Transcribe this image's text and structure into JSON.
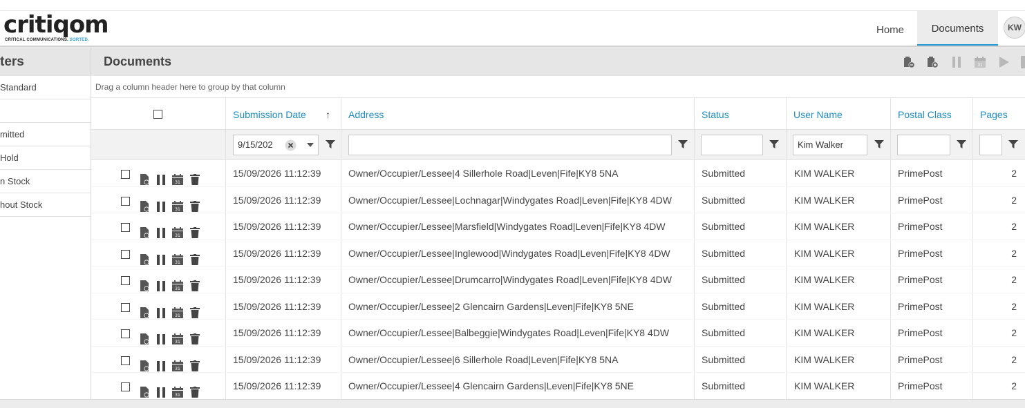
{
  "app": {
    "logo_text": "critiqom",
    "logo_tagline": "CRITICAL COMMUNICATIONS.",
    "logo_tagline_accent": "SORTED."
  },
  "nav": {
    "home": "Home",
    "documents": "Documents",
    "avatar_initials": "KW"
  },
  "sidebar": {
    "title": "ters",
    "items": [
      {
        "label": "Standard"
      },
      {
        "label": ""
      },
      {
        "label": "mitted"
      },
      {
        "label": "Hold"
      },
      {
        "label": "n Stock"
      },
      {
        "label": "hout Stock"
      }
    ]
  },
  "main": {
    "title": "Documents",
    "group_hint": "Drag a column header here to group by that column"
  },
  "grid": {
    "columns": {
      "submission_date": "Submission Date",
      "address": "Address",
      "status": "Status",
      "user_name": "User Name",
      "postal_class": "Postal Class",
      "pages": "Pages"
    },
    "sort_indicator": "↑",
    "filters": {
      "submission_date": "9/15/202",
      "address": "",
      "status": "",
      "user_name": "Kim Walker",
      "postal_class": "",
      "pages": ""
    },
    "rows": [
      {
        "date": "15/09/2026 11:12:39",
        "address": "Owner/Occupier/Lessee|4 Sillerhole Road|Leven|Fife|KY8 5NA",
        "status": "Submitted",
        "user": "KIM WALKER",
        "postal": "PrimePost",
        "pages": "2"
      },
      {
        "date": "15/09/2026 11:12:39",
        "address": "Owner/Occupier/Lessee|Lochnagar|Windygates Road|Leven|Fife|KY8 4DW",
        "status": "Submitted",
        "user": "KIM WALKER",
        "postal": "PrimePost",
        "pages": "2"
      },
      {
        "date": "15/09/2026 11:12:39",
        "address": "Owner/Occupier/Lessee|Marsfield|Windygates Road|Leven|Fife|KY8 4DW",
        "status": "Submitted",
        "user": "KIM WALKER",
        "postal": "PrimePost",
        "pages": "2"
      },
      {
        "date": "15/09/2026 11:12:39",
        "address": "Owner/Occupier/Lessee|Inglewood|Windygates Road|Leven|Fife|KY8 4DW",
        "status": "Submitted",
        "user": "KIM WALKER",
        "postal": "PrimePost",
        "pages": "2"
      },
      {
        "date": "15/09/2026 11:12:39",
        "address": "Owner/Occupier/Lessee|Drumcarro|Windygates Road|Leven|Fife|KY8 4DW",
        "status": "Submitted",
        "user": "KIM WALKER",
        "postal": "PrimePost",
        "pages": "2"
      },
      {
        "date": "15/09/2026 11:12:39",
        "address": "Owner/Occupier/Lessee|2 Glencairn Gardens|Leven|Fife|KY8 5NE",
        "status": "Submitted",
        "user": "KIM WALKER",
        "postal": "PrimePost",
        "pages": "2"
      },
      {
        "date": "15/09/2026 11:12:39",
        "address": "Owner/Occupier/Lessee|Balbeggie|Windygates Road|Leven|Fife|KY8 4DW",
        "status": "Submitted",
        "user": "KIM WALKER",
        "postal": "PrimePost",
        "pages": "2"
      },
      {
        "date": "15/09/2026 11:12:39",
        "address": "Owner/Occupier/Lessee|6 Sillerhole Road|Leven|Fife|KY8 5NA",
        "status": "Submitted",
        "user": "KIM WALKER",
        "postal": "PrimePost",
        "pages": "2"
      },
      {
        "date": "15/09/2026 11:12:39",
        "address": "Owner/Occupier/Lessee|4 Glencairn Gardens|Leven|Fife|KY8 5NE",
        "status": "Submitted",
        "user": "KIM WALKER",
        "postal": "PrimePost",
        "pages": "2"
      }
    ]
  },
  "icons": {
    "row_actions": [
      "document-icon",
      "pause-icon",
      "calendar-icon",
      "trash-icon"
    ],
    "toolbar": [
      "clipboard-remove-icon",
      "clipboard-add-icon",
      "pause-icon",
      "calendar-icon",
      "play-icon"
    ]
  },
  "colors": {
    "accent": "#1e8bc3",
    "header_bg": "#e6e6e6",
    "filter_bg": "#f2f2f2"
  }
}
